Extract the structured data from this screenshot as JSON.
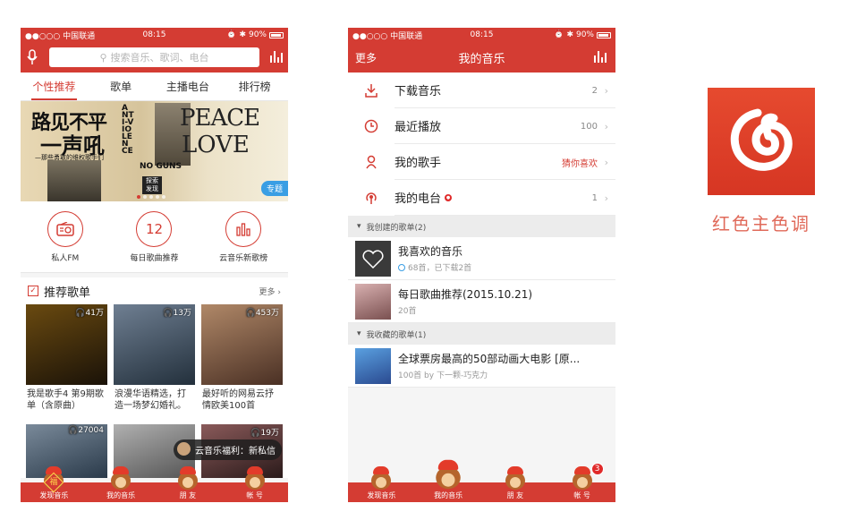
{
  "colors": {
    "accent": "#d43c33",
    "logo_bg": "#e0412a",
    "caption": "#e06a5a",
    "badge_blue": "#3a9ee4"
  },
  "status_bar": {
    "carrier": "●●○○○ 中国联通",
    "time": "08:15",
    "battery": "90%"
  },
  "phone1": {
    "search_placeholder": "搜索音乐、歌词、电台",
    "tabs": [
      {
        "label": "个性推荐",
        "active": true
      },
      {
        "label": "歌单",
        "active": false
      },
      {
        "label": "主播电台",
        "active": false
      },
      {
        "label": "排行榜",
        "active": false
      }
    ],
    "banner": {
      "line1": "路见不平",
      "line2": "一声吼",
      "line3": "—那些勇敢的维权歌手们",
      "vertical": "ANTI-VIOLENCE",
      "peace": "PEACE",
      "love": "LOVE",
      "noguns": "NO GUNS",
      "tansuo": "探索 发现",
      "tag": "专题"
    },
    "quick": [
      {
        "icon": "radio-icon",
        "label": "私人FM"
      },
      {
        "icon": "calendar-icon",
        "number": "12",
        "label": "每日歌曲推荐"
      },
      {
        "icon": "chart-bars-icon",
        "label": "云音乐新歌榜"
      }
    ],
    "section": {
      "title": "推荐歌单",
      "more": "更多"
    },
    "playlists": [
      {
        "count": "41万",
        "title": "我是歌手4 第9期歌单（含原曲）",
        "cover": "#3a2a10"
      },
      {
        "count": "13万",
        "title": "浪漫华语精选，打造一场梦幻婚礼。",
        "cover": "#3b4a5c"
      },
      {
        "count": "453万",
        "title": "最好听的网易云抒情欧美100首",
        "cover": "#7a5a48"
      }
    ],
    "playlists_row2": [
      {
        "count": "27004",
        "cover": "#4a5a6a"
      },
      {
        "count": "",
        "cover": "#8a8a8a"
      },
      {
        "count": "19万",
        "cover": "#5a3a3a"
      }
    ],
    "toast": "云音乐福利：新私信",
    "nav": [
      {
        "label": "发现音乐",
        "active": true
      },
      {
        "label": "我的音乐",
        "active": false
      },
      {
        "label": "朋 友",
        "active": false
      },
      {
        "label": "帐 号",
        "active": false
      }
    ],
    "fu_char": "福"
  },
  "phone2": {
    "header": {
      "left": "更多",
      "title": "我的音乐"
    },
    "rows": [
      {
        "icon": "download-icon",
        "label": "下载音乐",
        "value": "2",
        "value_red": false,
        "dot": false
      },
      {
        "icon": "clock-icon",
        "label": "最近播放",
        "value": "100",
        "value_red": false,
        "dot": false
      },
      {
        "icon": "singer-icon",
        "label": "我的歌手",
        "value": "猜你喜欢",
        "value_red": true,
        "dot": false
      },
      {
        "icon": "podcast-icon",
        "label": "我的电台",
        "value": "1",
        "value_red": false,
        "dot": true
      }
    ],
    "group1": "我创建的歌单(2)",
    "created": [
      {
        "title": "我喜欢的音乐",
        "sub": "68首，已下载2首",
        "downloaded": true,
        "thumb": "#3a3a3a"
      },
      {
        "title": "每日歌曲推荐(2015.10.21)",
        "sub": "20首",
        "downloaded": false,
        "thumb": "#c9a0a0"
      }
    ],
    "group2": "我收藏的歌单(1)",
    "collected": [
      {
        "title": "全球票房最高的50部动画大电影 [原...",
        "sub": "100首  by 下一颗-巧克力",
        "thumb": "#4a78b8"
      }
    ],
    "nav": [
      {
        "label": "发现音乐",
        "badge": ""
      },
      {
        "label": "我的音乐",
        "badge": ""
      },
      {
        "label": "朋 友",
        "badge": ""
      },
      {
        "label": "帐 号",
        "badge": "3"
      }
    ]
  },
  "brand": {
    "caption": "红色主色调",
    "logo_icon": "netease-music-logo"
  }
}
